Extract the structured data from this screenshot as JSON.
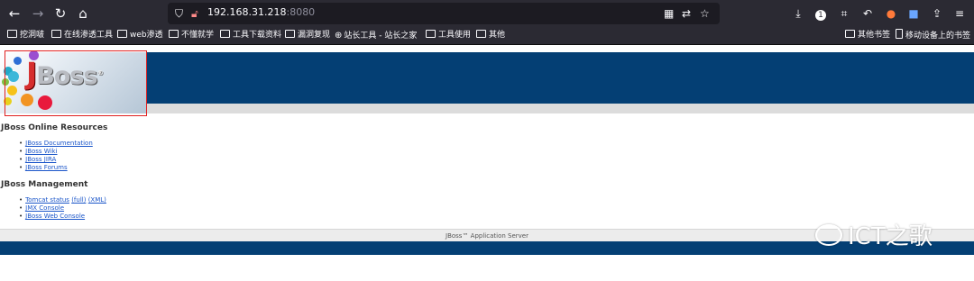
{
  "browser": {
    "url_host": "192.168.31.218",
    "url_port": ":8080",
    "bookmarks": [
      "挖洞啵",
      "在线渗透工具",
      "web渗透",
      "不懂就学",
      "工具下载资料",
      "漏洞复现",
      "站长工具 - 站长之家",
      "工具使用",
      "其他"
    ],
    "bookmarks_right": [
      "其他书签",
      "移动设备上的书签"
    ]
  },
  "page": {
    "logo_text_j": "J",
    "logo_text_rest": "Boss",
    "logo_mark": "®",
    "online_title": "JBoss Online Resources",
    "online_links": [
      "JBoss Documentation",
      "JBoss Wiki",
      "JBoss JIRA",
      "JBoss Forums"
    ],
    "mgmt_title": "JBoss Management",
    "tomcat_status": "Tomcat status",
    "tomcat_full": "(full)",
    "tomcat_xml": "(XML)",
    "mgmt_links": [
      "JMX Console",
      "JBoss Web Console"
    ],
    "footer": "JBoss™ Application Server"
  },
  "watermark": {
    "text": "ICT之歌"
  }
}
